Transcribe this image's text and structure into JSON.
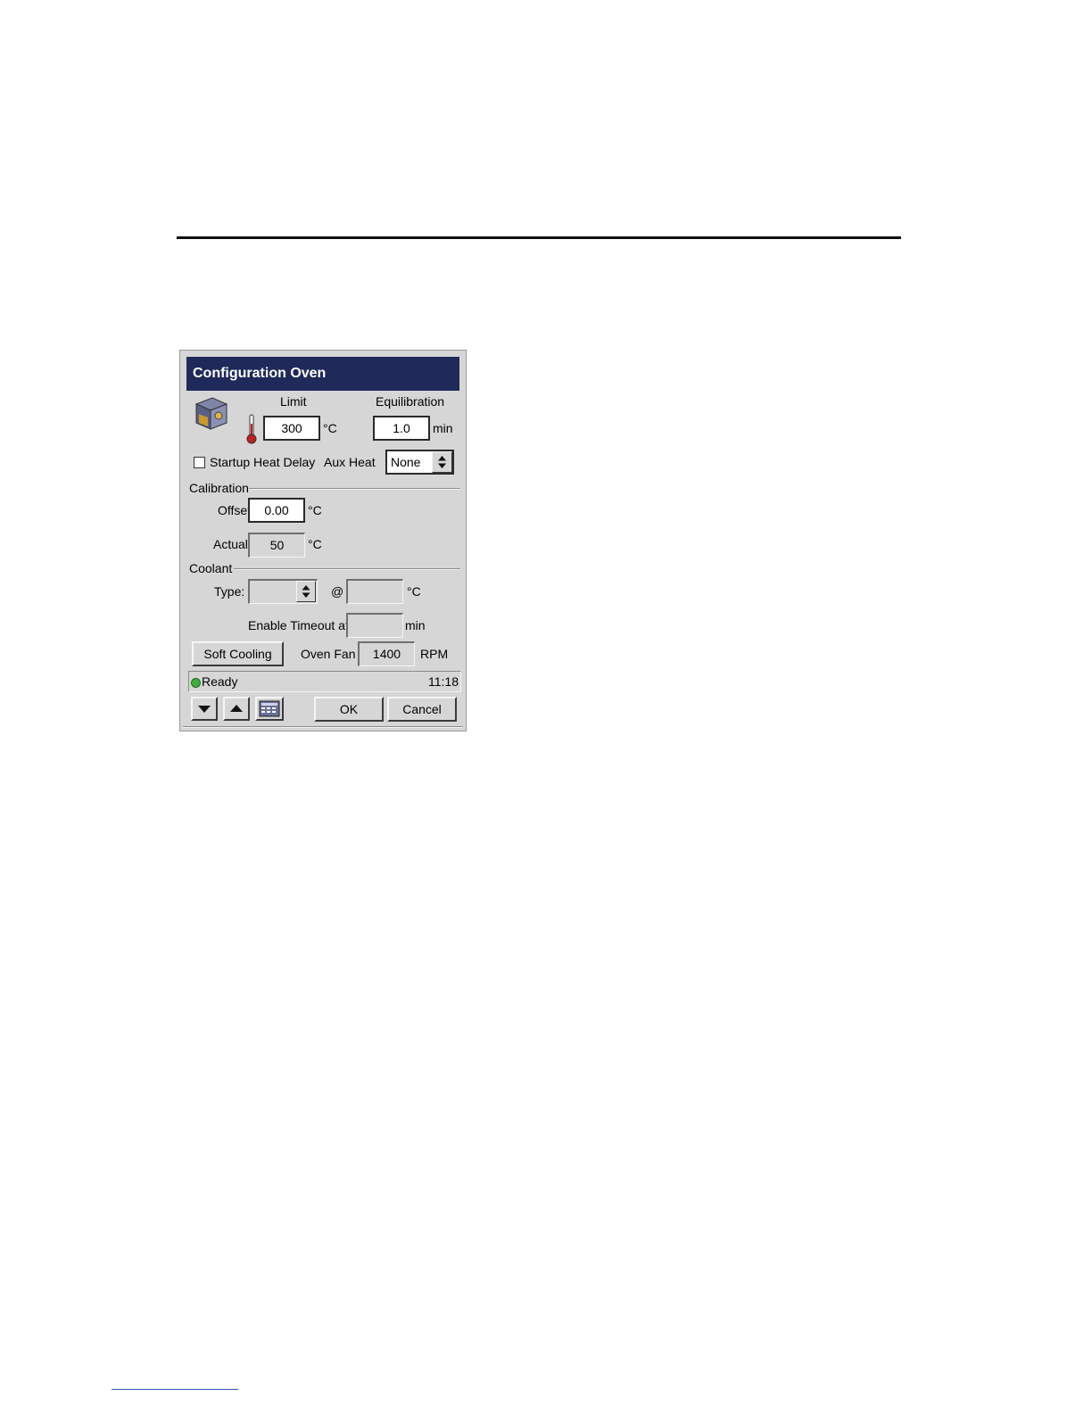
{
  "dialog": {
    "title": "Configuration Oven",
    "limit": {
      "label": "Limit",
      "value": "300",
      "unit": "°C"
    },
    "equilibration": {
      "label": "Equilibration",
      "value": "1.0",
      "unit": "min"
    },
    "startup_heat_delay": {
      "label": "Startup Heat Delay",
      "checked": false
    },
    "aux_heat": {
      "label": "Aux Heat",
      "value": "None"
    },
    "calibration": {
      "header": "Calibration",
      "offset_label": "Offset",
      "offset_value": "0.00",
      "offset_unit": "°C",
      "actual_label": "Actual",
      "actual_value": "50",
      "actual_unit": "°C"
    },
    "coolant": {
      "header": "Coolant",
      "type_label": "Type:",
      "type_value": "",
      "at_label": "@",
      "temp_value": "",
      "temp_unit": "°C",
      "timeout_label": "Enable Timeout at",
      "timeout_value": "",
      "timeout_unit": "min"
    },
    "soft_cooling_label": "Soft Cooling",
    "oven_fan": {
      "label": "Oven Fan",
      "value": "1400",
      "unit": "RPM"
    },
    "status": {
      "text": "Ready",
      "time": "11:18",
      "indicator_color": "#3fae3a"
    },
    "buttons": {
      "ok": "OK",
      "cancel": "Cancel"
    },
    "icons": [
      "oven-icon",
      "thermometer-icon",
      "arrow-down-icon",
      "arrow-up-icon",
      "keypad-icon"
    ]
  }
}
